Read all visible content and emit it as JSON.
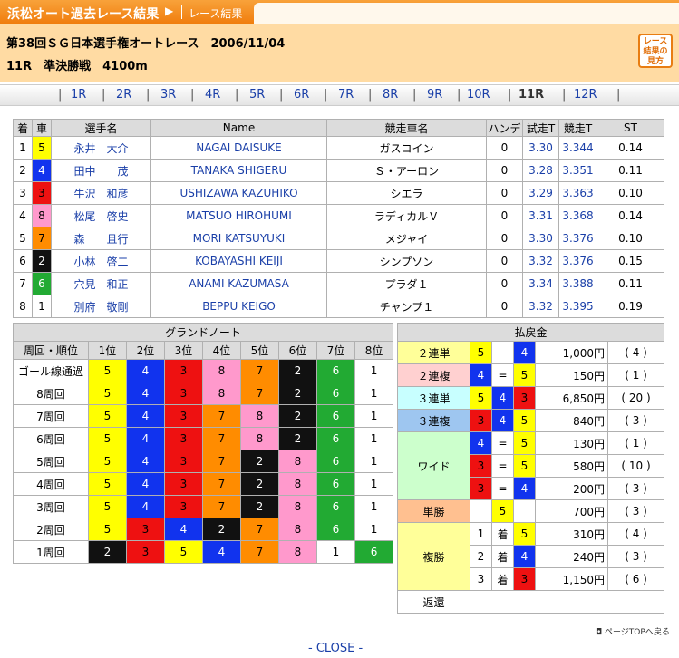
{
  "header": {
    "title": "浜松オート過去レース結果",
    "arrow": "▶",
    "sub": "レース結果"
  },
  "race": {
    "line1": "第38回ＳＧ日本選手権オートレース　2006/11/04",
    "line2": "11R　準決勝戦　4100m",
    "badge": "レース結果の見方"
  },
  "nav": {
    "items": [
      "1R",
      "2R",
      "3R",
      "4R",
      "5R",
      "6R",
      "7R",
      "8R",
      "9R",
      "10R",
      "11R",
      "12R"
    ],
    "current": "11R"
  },
  "results": {
    "headers": [
      "着",
      "車",
      "選手名",
      "Name",
      "競走車名",
      "ハンデ",
      "試走T",
      "競走T",
      "ST"
    ],
    "rows": [
      {
        "rank": "1",
        "car": "5",
        "jp": "永井　大介",
        "en": "NAGAI DAISUKE",
        "bike": "ガスコイン",
        "handi": "0",
        "test": "3.30",
        "race": "3.344",
        "st": "0.14"
      },
      {
        "rank": "2",
        "car": "4",
        "jp": "田中　　茂",
        "en": "TANAKA SHIGERU",
        "bike": "Ｓ・アーロン",
        "handi": "0",
        "test": "3.28",
        "race": "3.351",
        "st": "0.11"
      },
      {
        "rank": "3",
        "car": "3",
        "jp": "牛沢　和彦",
        "en": "USHIZAWA KAZUHIKO",
        "bike": "シエラ",
        "handi": "0",
        "test": "3.29",
        "race": "3.363",
        "st": "0.10"
      },
      {
        "rank": "4",
        "car": "8",
        "jp": "松尾　啓史",
        "en": "MATSUO HIROHUMI",
        "bike": "ラディカルＶ",
        "handi": "0",
        "test": "3.31",
        "race": "3.368",
        "st": "0.14"
      },
      {
        "rank": "5",
        "car": "7",
        "jp": "森　　且行",
        "en": "MORI KATSUYUKI",
        "bike": "メジャイ",
        "handi": "0",
        "test": "3.30",
        "race": "3.376",
        "st": "0.10"
      },
      {
        "rank": "6",
        "car": "2",
        "jp": "小林　啓二",
        "en": "KOBAYASHI KEIJI",
        "bike": "シンプソン",
        "handi": "0",
        "test": "3.32",
        "race": "3.376",
        "st": "0.15"
      },
      {
        "rank": "7",
        "car": "6",
        "jp": "穴見　和正",
        "en": "ANAMI KAZUMASA",
        "bike": "プラダ１",
        "handi": "0",
        "test": "3.34",
        "race": "3.388",
        "st": "0.11"
      },
      {
        "rank": "8",
        "car": "1",
        "jp": "別府　敬剛",
        "en": "BEPPU KEIGO",
        "bike": "チャンプ１",
        "handi": "0",
        "test": "3.32",
        "race": "3.395",
        "st": "0.19"
      }
    ]
  },
  "grand_note": {
    "title": "グランドノート",
    "headers": [
      "周回・順位",
      "1位",
      "2位",
      "3位",
      "4位",
      "5位",
      "6位",
      "7位",
      "8位"
    ],
    "rows": [
      {
        "label": "ゴール線通過",
        "cars": [
          "5",
          "4",
          "3",
          "8",
          "7",
          "2",
          "6",
          "1"
        ]
      },
      {
        "label": "8周回",
        "cars": [
          "5",
          "4",
          "3",
          "8",
          "7",
          "2",
          "6",
          "1"
        ]
      },
      {
        "label": "7周回",
        "cars": [
          "5",
          "4",
          "3",
          "7",
          "8",
          "2",
          "6",
          "1"
        ]
      },
      {
        "label": "6周回",
        "cars": [
          "5",
          "4",
          "3",
          "7",
          "8",
          "2",
          "6",
          "1"
        ]
      },
      {
        "label": "5周回",
        "cars": [
          "5",
          "4",
          "3",
          "7",
          "2",
          "8",
          "6",
          "1"
        ]
      },
      {
        "label": "4周回",
        "cars": [
          "5",
          "4",
          "3",
          "7",
          "2",
          "8",
          "6",
          "1"
        ]
      },
      {
        "label": "3周回",
        "cars": [
          "5",
          "4",
          "3",
          "7",
          "2",
          "8",
          "6",
          "1"
        ]
      },
      {
        "label": "2周回",
        "cars": [
          "5",
          "3",
          "4",
          "2",
          "7",
          "8",
          "6",
          "1"
        ]
      },
      {
        "label": "1周回",
        "cars": [
          "2",
          "3",
          "5",
          "4",
          "7",
          "8",
          "1",
          "6"
        ]
      }
    ]
  },
  "payout": {
    "title": "払戻金",
    "rentan2": {
      "label": "２連単",
      "a": "5",
      "op": "－",
      "b": "4",
      "amount": "1,000円",
      "pop": "( 4 )"
    },
    "renpuku2": {
      "label": "２連複",
      "a": "4",
      "op": "=",
      "b": "5",
      "amount": "150円",
      "pop": "( 1 )"
    },
    "rentan3": {
      "label": "３連単",
      "a": "5",
      "b": "4",
      "c": "3",
      "amount": "6,850円",
      "pop": "( 20 )"
    },
    "renpuku3": {
      "label": "３連複",
      "a": "3",
      "b": "4",
      "c": "5",
      "amount": "840円",
      "pop": "( 3 )"
    },
    "wide": {
      "label": "ワイド",
      "rows": [
        {
          "a": "4",
          "op": "=",
          "b": "5",
          "amount": "130円",
          "pop": "( 1 )"
        },
        {
          "a": "3",
          "op": "=",
          "b": "5",
          "amount": "580円",
          "pop": "( 10 )"
        },
        {
          "a": "3",
          "op": "=",
          "b": "4",
          "amount": "200円",
          "pop": "( 3 )"
        }
      ]
    },
    "tansho": {
      "label": "単勝",
      "car": "5",
      "amount": "700円",
      "pop": "( 3 )"
    },
    "fukusho": {
      "label": "複勝",
      "rows": [
        {
          "rank": "1",
          "chaku": "着",
          "car": "5",
          "amount": "310円",
          "pop": "( 4 )"
        },
        {
          "rank": "2",
          "chaku": "着",
          "car": "4",
          "amount": "240円",
          "pop": "( 3 )"
        },
        {
          "rank": "3",
          "chaku": "着",
          "car": "3",
          "amount": "1,150円",
          "pop": "( 6 )"
        }
      ]
    },
    "henkan": {
      "label": "返還"
    }
  },
  "footer": {
    "top_link": "ページTOPへ戻る",
    "close": "- CLOSE -"
  }
}
